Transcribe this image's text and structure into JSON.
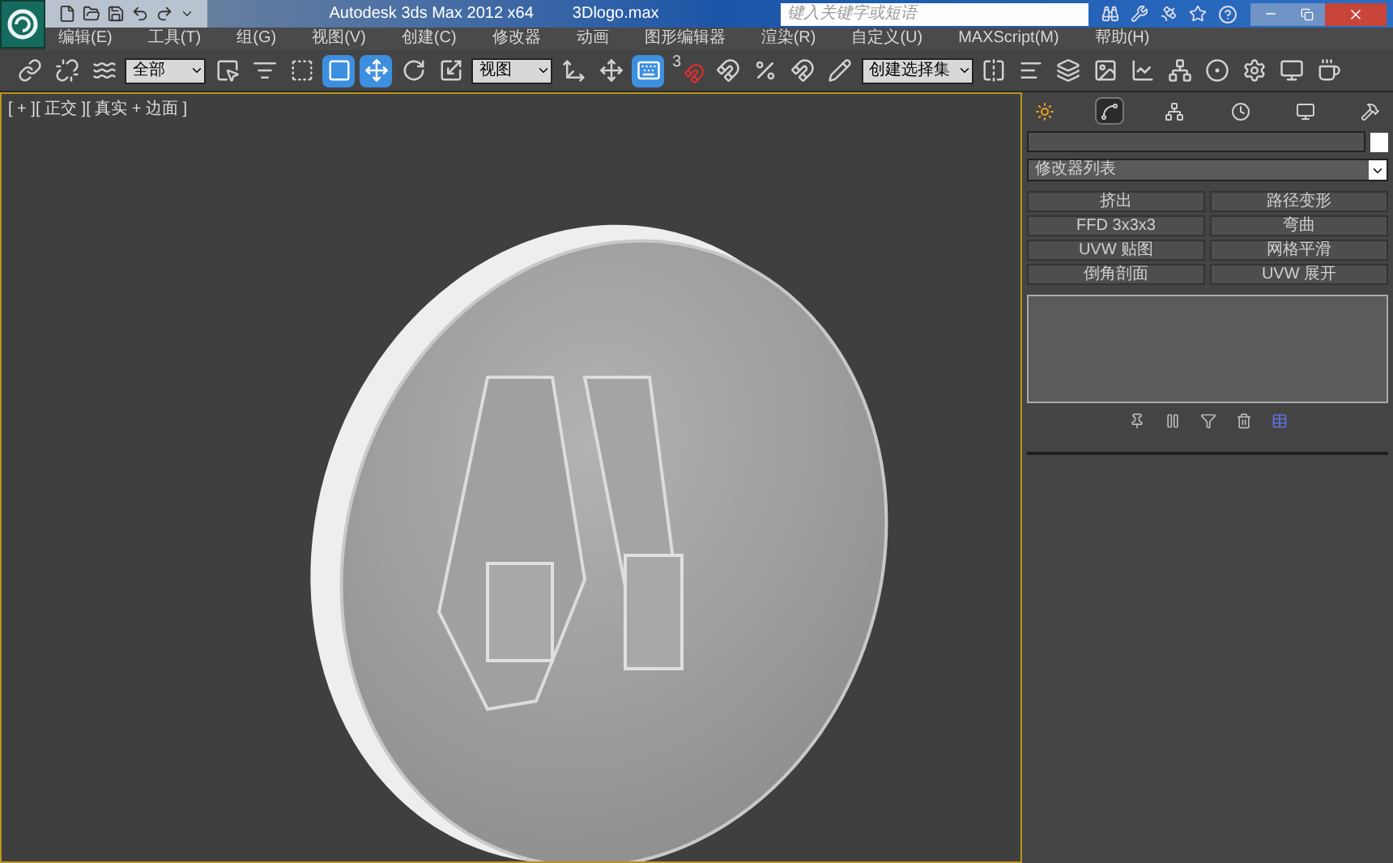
{
  "window": {
    "title": "Autodesk 3ds Max  2012 x64",
    "file": "3Dlogo.max"
  },
  "search": {
    "placeholder": "键入关键字或短语"
  },
  "menu": [
    "编辑(E)",
    "工具(T)",
    "组(G)",
    "视图(V)",
    "创建(C)",
    "修改器",
    "动画",
    "图形编辑器",
    "渲染(R)",
    "自定义(U)",
    "MAXScript(M)",
    "帮助(H)"
  ],
  "toolbar": [
    {
      "kind": "tool",
      "selected": false
    },
    {
      "kind": "tool",
      "selected": false
    },
    {
      "kind": "tool",
      "selected": false
    },
    {
      "kind": "dropdown",
      "value": "全部"
    },
    {
      "kind": "tool",
      "selected": false
    },
    {
      "kind": "tool",
      "selected": false
    },
    {
      "kind": "tool",
      "selected": false
    },
    {
      "kind": "tool",
      "selected": true
    },
    {
      "kind": "tool",
      "selected": true
    },
    {
      "kind": "tool",
      "selected": false
    },
    {
      "kind": "tool",
      "selected": false
    },
    {
      "kind": "dropdown",
      "value": "视图"
    },
    {
      "kind": "tool",
      "selected": false
    },
    {
      "kind": "tool",
      "selected": false
    },
    {
      "kind": "tool",
      "selected": true
    },
    {
      "kind": "snap",
      "label": "3",
      "selected": false
    },
    {
      "kind": "tool",
      "selected": false
    },
    {
      "kind": "tool",
      "selected": false
    },
    {
      "kind": "tool",
      "selected": false
    },
    {
      "kind": "tool",
      "selected": false
    },
    {
      "kind": "dropdown",
      "value": "创建选择集"
    },
    {
      "kind": "tool",
      "selected": false
    },
    {
      "kind": "tool",
      "selected": false
    },
    {
      "kind": "tool",
      "selected": false
    },
    {
      "kind": "tool",
      "selected": false
    },
    {
      "kind": "tool",
      "selected": false
    },
    {
      "kind": "tool",
      "selected": false
    },
    {
      "kind": "tool",
      "selected": false
    },
    {
      "kind": "tool",
      "selected": false
    },
    {
      "kind": "tool",
      "selected": false
    },
    {
      "kind": "tool",
      "selected": false
    }
  ],
  "viewport": {
    "label": "[ + ][ 正交 ][ 真实 + 边面 ]"
  },
  "command_panel": {
    "tabs": [
      {
        "selected": false
      },
      {
        "selected": true
      },
      {
        "selected": false
      },
      {
        "selected": false
      },
      {
        "selected": false
      },
      {
        "selected": false
      }
    ],
    "modifier_list": "修改器列表",
    "modifier_buttons": [
      "挤出",
      "路径变形",
      "FFD 3x3x3",
      "弯曲",
      "UVW 贴图",
      "网格平滑",
      "倒角剖面",
      "UVW 展开"
    ]
  }
}
